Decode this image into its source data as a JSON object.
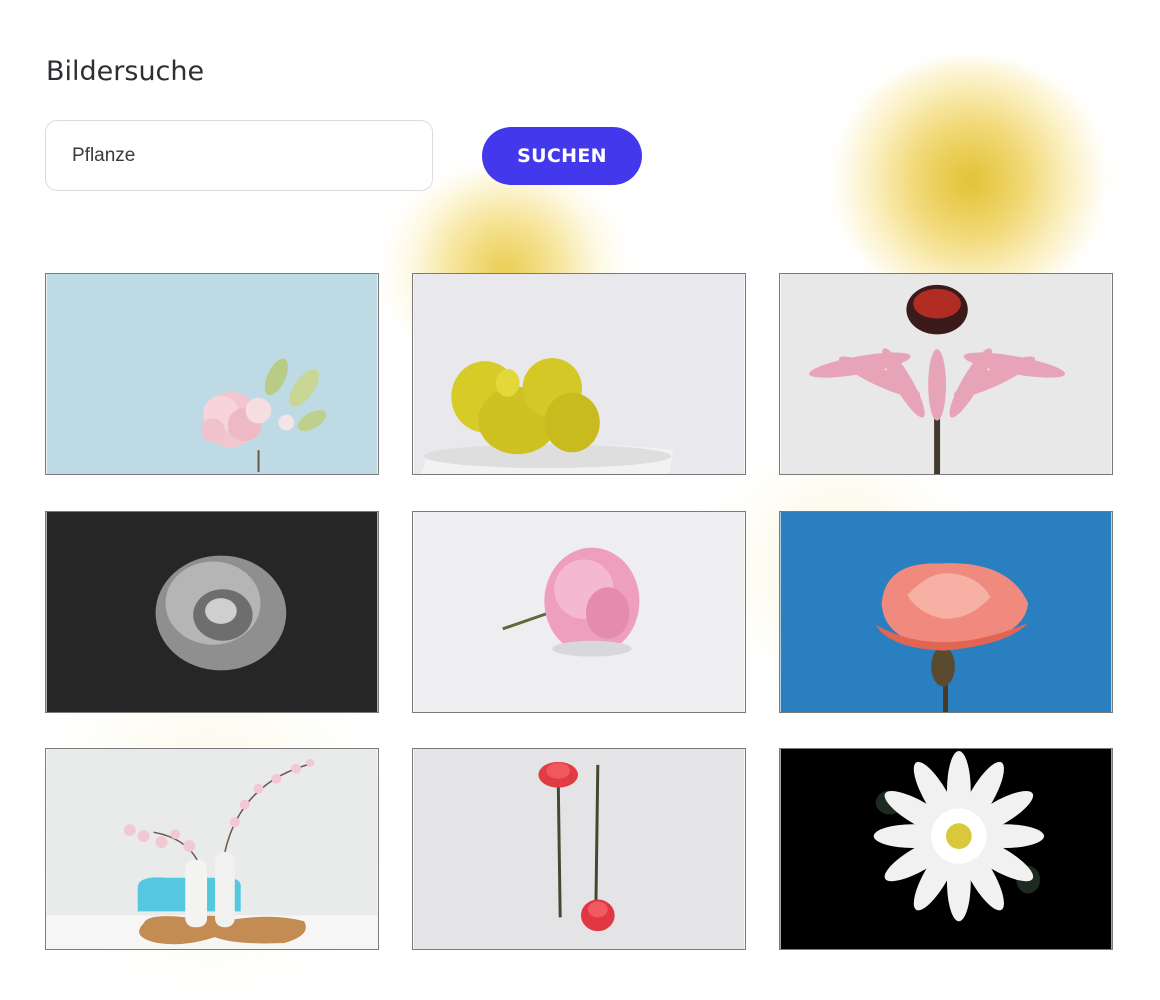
{
  "page": {
    "title": "Bildersuche"
  },
  "search": {
    "value": "Pflanze",
    "button_label": "SUCHEN"
  },
  "colors": {
    "accent": "#4438ec",
    "glow": "#e6c232"
  },
  "results": [
    {
      "subject": "pink-blossom",
      "background": "#bedbe5"
    },
    {
      "subject": "yellow-cactus",
      "background": "#e9e8ec"
    },
    {
      "subject": "pink-coneflower",
      "background": "#e8e8e8"
    },
    {
      "subject": "grey-rose",
      "background": "#262626"
    },
    {
      "subject": "pink-carnation",
      "background": "#eeeef0"
    },
    {
      "subject": "coral-rose",
      "background": "#2a7fc0"
    },
    {
      "subject": "blossom-vases",
      "background": "#e9eaea"
    },
    {
      "subject": "red-carnations",
      "background": "#e4e4e6"
    },
    {
      "subject": "white-dahlia",
      "background": "#000000"
    }
  ]
}
